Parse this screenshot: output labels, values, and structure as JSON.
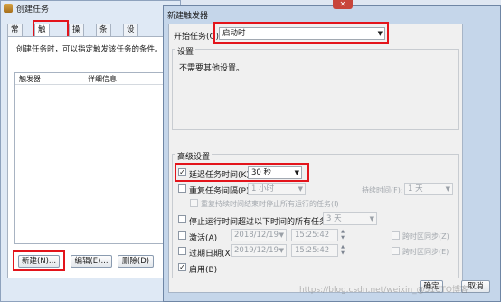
{
  "background_window": {
    "title": "创建任务",
    "tabs": [
      "常规",
      "触发器",
      "操作",
      "条件",
      "设置"
    ],
    "active_tab": "触发器",
    "description": "创建任务时，可以指定触发该任务的条件。",
    "list_headers": [
      "触发器",
      "详细信息"
    ],
    "buttons": {
      "new": "新建(N)...",
      "edit": "编辑(E)...",
      "delete": "删除(D)"
    }
  },
  "dialog": {
    "title": "新建触发器",
    "close": "✕",
    "start_task_label": "开始任务(G):",
    "start_task_value": "启动时",
    "settings_label": "设置",
    "settings_text": "不需要其他设置。",
    "advanced_label": "高级设置",
    "delay": {
      "label": "延迟任务时间(K):",
      "value": "30 秒",
      "checked": true
    },
    "repeat": {
      "label": "重复任务间隔(P):",
      "value": "1 小时",
      "duration_label": "持续时间(F):",
      "duration_value": "1 天"
    },
    "stop_repeat_text": "重复持续时间结束时停止所有运行的任务(I)",
    "stop_longer": {
      "label": "停止运行时间超过以下时间的所有任务(L):",
      "value": "3 天"
    },
    "activate": {
      "label": "激活(A)",
      "date": "2018/12/19",
      "time": "15:25:42",
      "sync": "跨时区同步(Z)"
    },
    "expire": {
      "label": "过期日期(X):",
      "date": "2019/12/19",
      "time": "15:25:42",
      "sync": "跨时区同步(E)"
    },
    "enabled": {
      "label": "启用(B)",
      "checked": true
    },
    "ok": "确定",
    "cancel": "取消",
    "check_mark": "✓"
  },
  "watermark": "https://blog.csdn.net/weixin_@51CTO博客"
}
